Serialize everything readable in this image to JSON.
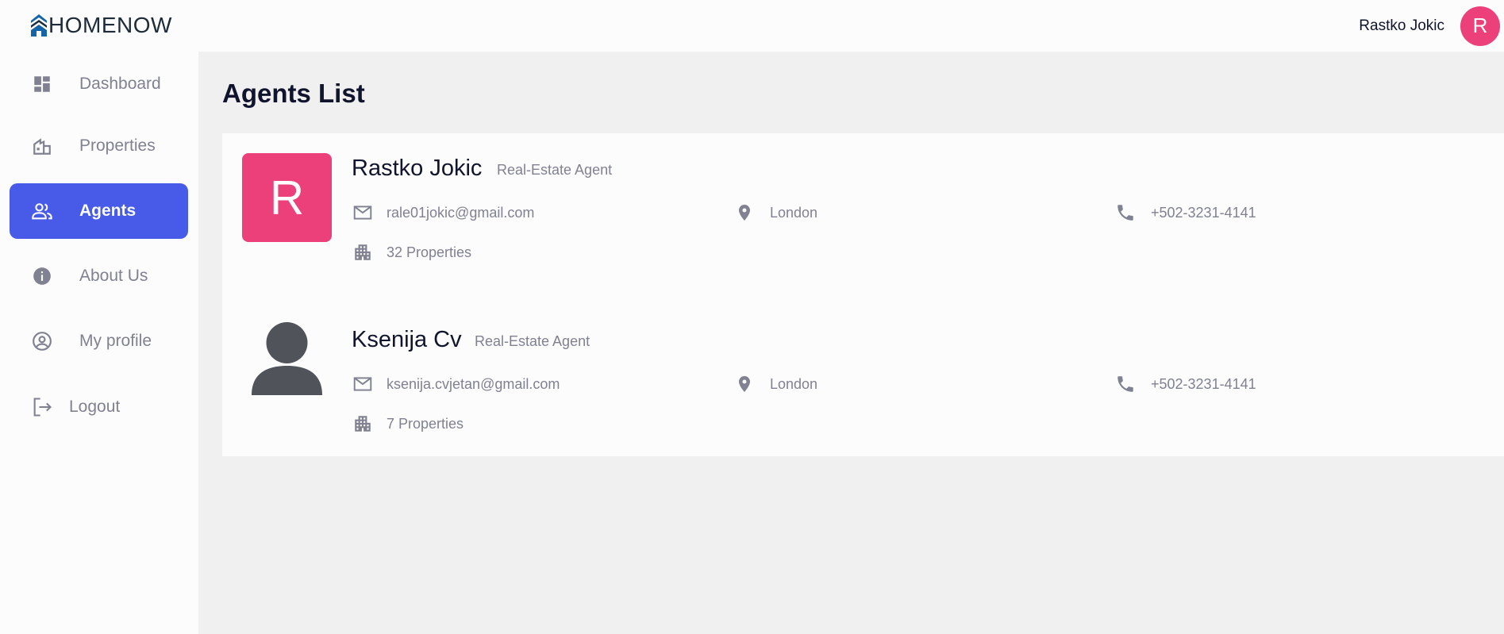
{
  "brand": {
    "name": "HOMENOW"
  },
  "header": {
    "user_name": "Rastko Jokic",
    "avatar_letter": "R"
  },
  "colors": {
    "accent": "#475be8",
    "avatar": "#ec407a",
    "muted": "#808191",
    "text": "#11142d"
  },
  "sidebar": {
    "items": [
      {
        "label": "Dashboard",
        "icon": "dashboard-icon",
        "active": false
      },
      {
        "label": "Properties",
        "icon": "villa-icon",
        "active": false
      },
      {
        "label": "Agents",
        "icon": "people-icon",
        "active": true
      },
      {
        "label": "About Us",
        "icon": "info-icon",
        "active": false
      },
      {
        "label": "My profile",
        "icon": "account-circle-icon",
        "active": false
      },
      {
        "label": "Logout",
        "icon": "logout-icon",
        "active": false
      }
    ]
  },
  "main": {
    "title": "Agents List",
    "agents": [
      {
        "name": "Rastko Jokic",
        "role": "Real-Estate Agent",
        "avatar_letter": "R",
        "email": "rale01jokic@gmail.com",
        "location": "London",
        "phone": "+502-3231-4141",
        "properties": "32 Properties"
      },
      {
        "name": "Ksenija Cv",
        "role": "Real-Estate Agent",
        "avatar_letter": "",
        "email": "ksenija.cvjetan@gmail.com",
        "location": "London",
        "phone": "+502-3231-4141",
        "properties": "7 Properties"
      }
    ]
  }
}
